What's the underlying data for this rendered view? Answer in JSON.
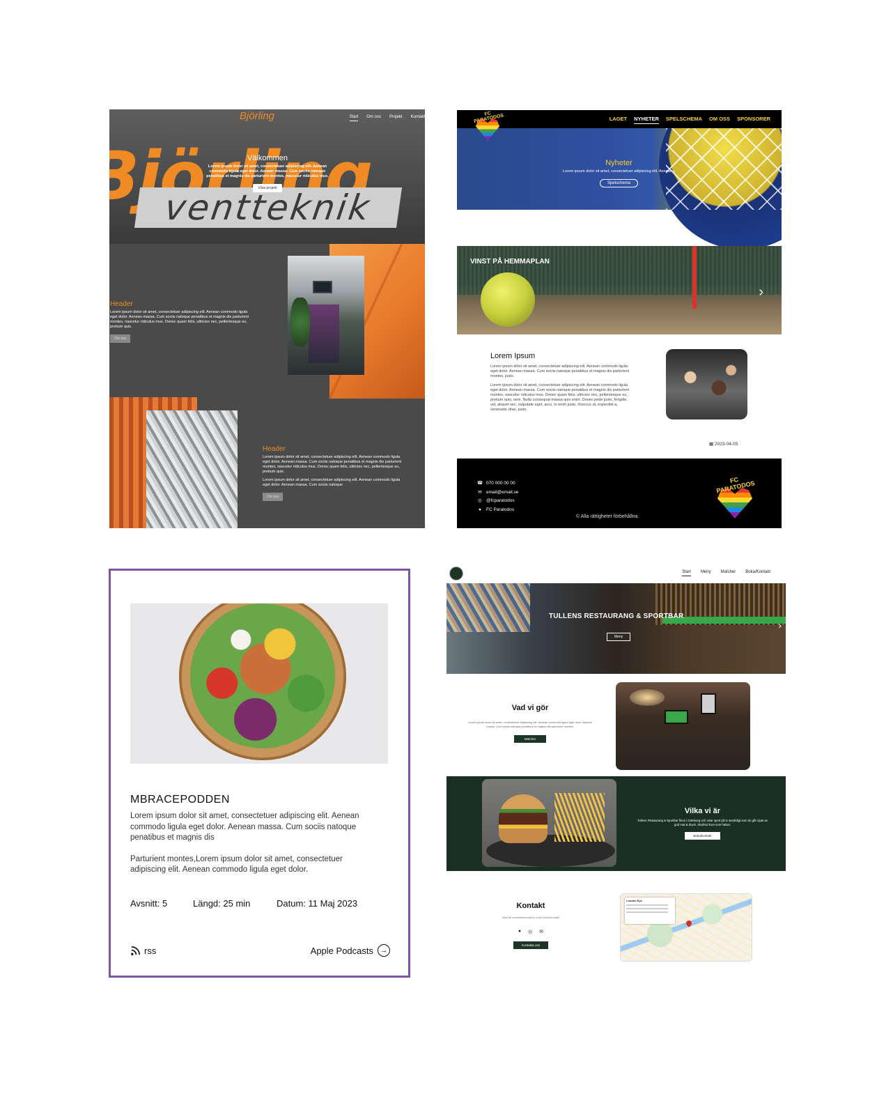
{
  "bjorling": {
    "logo": "Björling",
    "nav": [
      "Start",
      "Om oss",
      "Projekt",
      "Kontakt"
    ],
    "hero_bigtext": "Björling",
    "hero_bigtext2": "ventteknik",
    "welcome_title": "Välkommen",
    "welcome_text": "Lorem ipsum dolor sit amet, consectetuer adipiscing elit. Aenean commodo ligula eget dolor. Aenean massa. Cum sociis natoque penatibus et magnis dis parturient montes, nascetur ridiculus mus.",
    "welcome_button": "Våra projekt",
    "section1_heading": "Header",
    "section1_text": "Lorem ipsum dolor sit amet, consectetuer adipiscing elit. Aenean commodo ligula eget dolor. Aenean massa. Cum sociis natoque penatibus et magnis dis parturient montes, nascetur ridiculus mus. Donec quam felis, ultricies nec, pellentesque eu, pretium quis.",
    "section1_button": "Om oss",
    "section2_heading": "Header",
    "section2_text1": "Lorem ipsum dolor sit amet, consectetuer adipiscing elit. Aenean commodo ligula eget dolor. Aenean massa. Cum sociis natoque penatibus et magnis dis parturient montes, nascetur ridiculus mus. Donec quam felis, ultricies nec, pellentesque eu, pretium quis.",
    "section2_text2": "Lorem ipsum dolor sit amet, consectetuer adipiscing elit. Aenean commodo ligula eget dolor. Aenean massa. Cum sociis natoque",
    "section2_button": "Om oss"
  },
  "paratodos": {
    "logo_text": "FC PARATODOS",
    "nav": [
      "LAGET",
      "NYHETER",
      "SPELSCHEMA",
      "OM OSS",
      "SPONSORER"
    ],
    "hero_title": "Nyheter",
    "hero_text": "Lorem ipsum dolor sit amet, consectetuer adipiscing elit. Aenean c",
    "hero_button": "Spelschema",
    "banner_title": "VINST PÅ HEMMAPLAN",
    "article_title": "Lorem Ipsum",
    "article_p1": "Lorem ipsum dolor sit amet, consectetuer adipiscing elit. Aenean commodo ligula eget dolor. Aenean massa. Cum sociis natoque penatibus et magnis dis parturient montes, justo.",
    "article_p2": "Lorem ipsum dolor sit amet, consectetuer adipiscing elit. Aenean commodo ligula eget dolor. Aenean massa. Cum sociis natoque penatibus et magnis dis parturient montes, nascetur ridiculus mus. Donec quam felis, ultricies nec, pellentesque eu, pretium quis, sem. Nulla consequat massa quis enim. Donec pede justo, fringilla vel, aliquet nec, vulputate eget, arcu. In enim justo, rhoncus ut, imperdiet a, venenatis vitae, justo.",
    "article_date": "2023-04-05",
    "contact_phone": "070 000 00 00",
    "contact_email": "email@email.se",
    "contact_instagram": "@fcparatodos",
    "contact_facebook": "FC Paratodos",
    "copyright": "© Alla rättigheter förbehållna."
  },
  "podcast": {
    "title": "MBRACEPODDEN",
    "p1": "Lorem ipsum dolor sit amet, consectetuer adipiscing elit. Aenean commodo ligula eget dolor. Aenean massa. Cum sociis natoque penatibus et magnis dis",
    "p2": "Parturient montes,Lorem ipsum dolor sit amet, consectetuer adipiscing elit. Aenean commodo ligula eget dolor.",
    "episode": "Avsnitt: 5",
    "length": "Längd: 25 min",
    "date": "Datum: 11 Maj 2023",
    "rss_label": "rss",
    "apple_label": "Apple Podcasts",
    "border_color": "#7d55a6"
  },
  "tullens": {
    "nav": [
      "Start",
      "Meny",
      "Matcher",
      "Boka/Kontakt"
    ],
    "hero_title": "TULLENS RESTAURANG & SPORTBAR",
    "hero_button": "Meny",
    "what_title": "Vad vi gör",
    "what_text": "Lorem ipsum dolor sit amet, consectetuer adipiscing elit. Aenean commodo ligula eget dolor. Aenean massa. Cum sociis natoque penatibus et magnis dis parturient montes.",
    "what_button": "Matcher",
    "who_title": "Vilka vi är",
    "who_text": "Tullens Restaurang & Sportbar finns i Göteborg och visar sport på tv samtidigt som du går njuta av god mat & dryck. Slutt/vid kom som hälsar.",
    "who_button": "Boka/kontakt",
    "contact_title": "Kontakt",
    "contact_text": "Hitta all kontaktinformation under Boka/kontakt",
    "contact_button": "Kontakta oss",
    "map_card_title": "London Eye",
    "brand_green": "#1b3025"
  }
}
